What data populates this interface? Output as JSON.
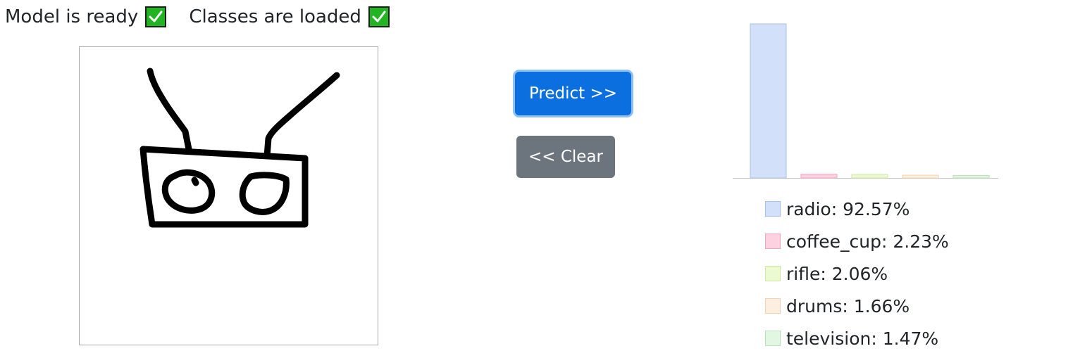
{
  "status": {
    "model_label": "Model is ready",
    "classes_label": "Classes are loaded",
    "check_color": "#22b422"
  },
  "buttons": {
    "predict_label": "Predict >>",
    "clear_label": "<< Clear",
    "predict_color": "#0b6fe0",
    "clear_color": "#6c757d"
  },
  "chart_data": {
    "type": "bar",
    "categories": [
      "radio",
      "coffee_cup",
      "rifle",
      "drums",
      "television"
    ],
    "values": [
      92.57,
      2.23,
      2.06,
      1.66,
      1.47
    ],
    "title": "",
    "xlabel": "",
    "ylabel": "",
    "ylim": [
      0,
      92.57
    ],
    "grid": false,
    "legend_position": "bottom",
    "fill_colors": [
      "#d3e0f9",
      "#fdd1e0",
      "#ecfad2",
      "#fdefdf",
      "#e2f7e2"
    ],
    "border_colors": [
      "#aabfe8",
      "#f2a7c0",
      "#cfe6a8",
      "#f2d2b2",
      "#b8e3b8"
    ]
  },
  "legend": {
    "items": [
      {
        "text": "radio: 92.57%"
      },
      {
        "text": "coffee_cup: 2.23%"
      },
      {
        "text": "rifle: 2.06%"
      },
      {
        "text": "drums: 1.66%"
      },
      {
        "text": "television: 1.47%"
      }
    ]
  }
}
